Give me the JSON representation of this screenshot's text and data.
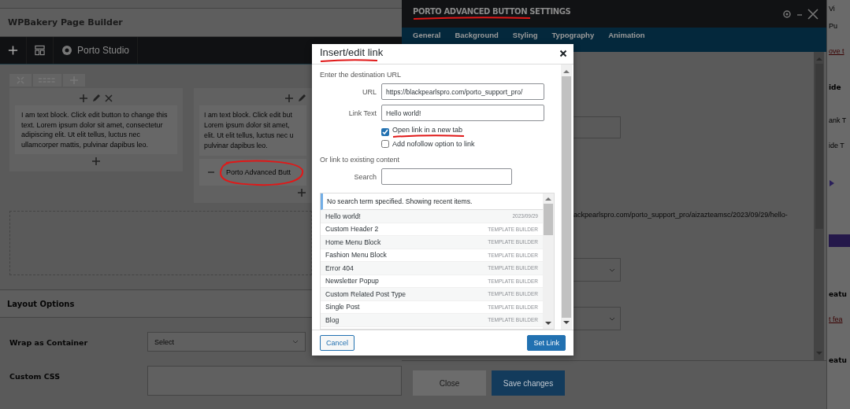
{
  "builder": {
    "title": "WPBakery Page Builder",
    "toolbar": {
      "studio_label": "Porto Studio"
    },
    "columns": [
      {
        "text": "I am text block. Click edit button to change this text. Lorem ipsum dolor sit amet, consectetur adipiscing elit. Ut elit tellus, luctus nec ullamcorper mattis, pulvinar dapibus leo."
      },
      {
        "text": "I am text block. Click edit but\nLorem ipsum dolor sit amet,\nelit. Ut elit tellus, luctus nec u\npulvinar dapibus leo.",
        "element": {
          "label": "Porto Advanced Butt",
          "annotated": true
        }
      }
    ]
  },
  "layout_options": {
    "title": "Layout Options",
    "fields": [
      {
        "label": "Wrap as Container",
        "kind": "select",
        "value": "Select"
      },
      {
        "label": "Custom CSS",
        "kind": "textarea"
      }
    ]
  },
  "settings_panel": {
    "title": "PORTO ADVANCED BUTTON SETTINGS",
    "title_annotated": true,
    "tabs": [
      {
        "label": "General"
      },
      {
        "label": "Background"
      },
      {
        "label": "Styling"
      },
      {
        "label": "Typography"
      },
      {
        "label": "Animation"
      }
    ],
    "fields": [
      {
        "kind": "input"
      },
      {
        "kind": "text",
        "text": "lackpearlspro.com/porto_support_pro/aizazteamsc/2023/09/29/hello-"
      },
      {
        "kind": "select"
      },
      {
        "kind": "select"
      }
    ],
    "buttons": [
      {
        "label": "Close",
        "kind": "secondary"
      },
      {
        "label": "Save changes",
        "kind": "primary"
      }
    ]
  },
  "dialog": {
    "title": "Insert/edit link",
    "title_annotated": true,
    "url_prompt": "Enter the destination URL",
    "url": {
      "label": "URL",
      "value": "https://blackpearlspro.com/porto_support_pro/"
    },
    "link_text": {
      "label": "Link Text",
      "value": "Hello world!"
    },
    "options": [
      {
        "label": "Open link in a new tab",
        "checked": true,
        "annotated": true
      },
      {
        "label": "Add nofollow option to link",
        "checked": false,
        "annotated": false
      }
    ],
    "existing_prompt": "Or link to existing content",
    "search": {
      "label": "Search"
    },
    "notice": "No search term specified. Showing recent items.",
    "results": [
      {
        "title": "Hello world!",
        "info": "2023/09/29"
      },
      {
        "title": "Custom Header 2",
        "info": "TEMPLATE BUILDER"
      },
      {
        "title": "Home Menu Block",
        "info": "TEMPLATE BUILDER"
      },
      {
        "title": "Fashion Menu Block",
        "info": "TEMPLATE BUILDER"
      },
      {
        "title": "Error 404",
        "info": "TEMPLATE BUILDER"
      },
      {
        "title": "Newsletter Popup",
        "info": "TEMPLATE BUILDER"
      },
      {
        "title": "Custom Related Post Type",
        "info": "TEMPLATE BUILDER"
      },
      {
        "title": "Single Post",
        "info": "TEMPLATE BUILDER"
      },
      {
        "title": "Blog",
        "info": "TEMPLATE BUILDER"
      }
    ],
    "buttons": [
      {
        "label": "Cancel",
        "kind": "secondary"
      },
      {
        "label": "Set Link",
        "kind": "primary"
      }
    ]
  },
  "side_strip": {
    "items": [
      {
        "kind": "plain",
        "text": "Vi"
      },
      {
        "kind": "plain",
        "text": "Pu"
      },
      {
        "kind": "link",
        "text": "ove t"
      },
      {
        "kind": "heading",
        "text": "ide"
      },
      {
        "kind": "plain",
        "text": "ank T"
      },
      {
        "kind": "plain",
        "text": "ide T"
      },
      {
        "kind": "icon"
      },
      {
        "kind": "bar"
      },
      {
        "kind": "heading",
        "text": "eatu"
      },
      {
        "kind": "link",
        "text": "t fea"
      },
      {
        "kind": "heading",
        "text": "eatu"
      }
    ]
  }
}
